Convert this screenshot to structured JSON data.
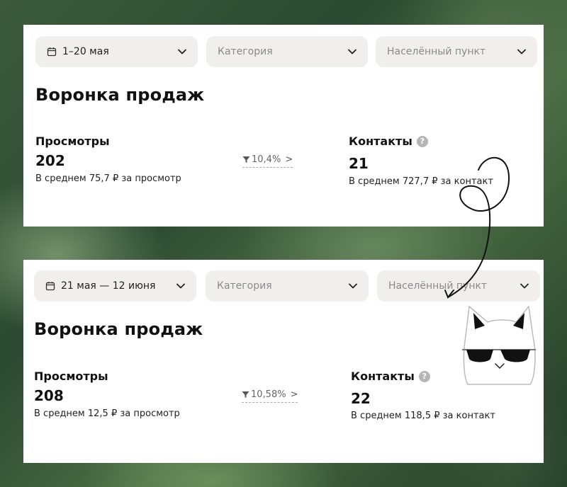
{
  "screens": [
    {
      "filters": {
        "date": "1–20 мая",
        "category_placeholder": "Категория",
        "locality_placeholder": "Населённый пункт"
      },
      "title": "Воронка продаж",
      "views": {
        "label": "Просмотры",
        "value": "202",
        "sub": "В среднем 75,7 ₽ за просмотр"
      },
      "conversion": "10,4%",
      "contacts": {
        "label": "Контакты",
        "value": "21",
        "sub": "В среднем 727,7 ₽ за контакт"
      }
    },
    {
      "filters": {
        "date": "21 мая — 12 июня",
        "category_placeholder": "Категория",
        "locality_placeholder": "Населённый пункт"
      },
      "title": "Воронка продаж",
      "views": {
        "label": "Просмотры",
        "value": "208",
        "sub": "В среднем 12,5 ₽ за просмотр"
      },
      "conversion": "10,58%",
      "contacts": {
        "label": "Контакты",
        "value": "22",
        "sub": "В среднем 118,5 ₽ за контакт"
      }
    }
  ],
  "icons": {
    "calendar": "calendar-icon",
    "chevron": "chevron-down-icon",
    "funnel": "funnel-icon",
    "help": "question-icon"
  },
  "help_glyph": "?",
  "arrow_glyph": ">",
  "colors": {
    "filter_bg": "#f1efec",
    "help_icon": "#b6b6b6"
  }
}
